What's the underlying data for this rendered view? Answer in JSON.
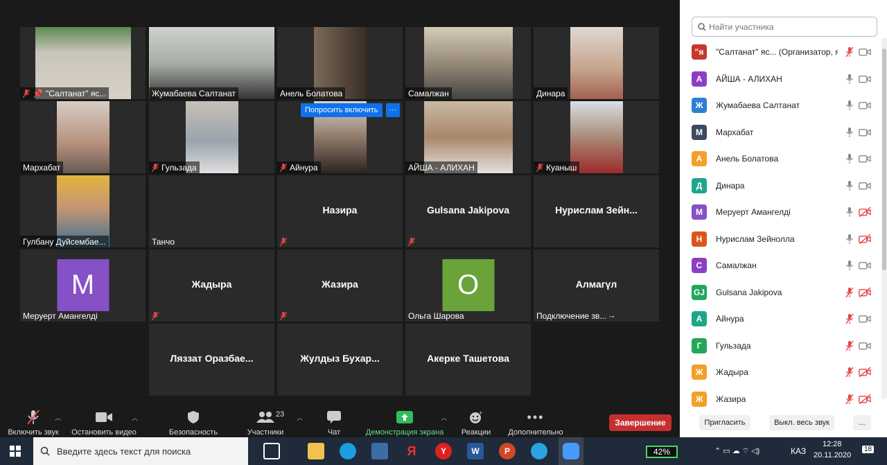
{
  "tiles_top": [
    {
      "name": "\"Салтанат\" яс...",
      "muted": true,
      "pinned": true
    },
    {
      "name": "Жумабаева Салтанат",
      "muted": false
    },
    {
      "name": "Анель Болатова",
      "muted": false
    },
    {
      "name": "Самалжан",
      "muted": false
    },
    {
      "name": "Динара",
      "muted": false
    }
  ],
  "tiles_row2": [
    {
      "name": "Мархабат",
      "muted": false
    },
    {
      "name": "Гульзада",
      "muted": true
    },
    {
      "name": "Айнура",
      "muted": true
    },
    {
      "name": "АЙША - АЛИХАН",
      "muted": false
    },
    {
      "name": "Куаныш",
      "muted": true
    }
  ],
  "tiles_row3": [
    {
      "name": "Гулбану Дуйсембае...",
      "muted": false
    },
    {
      "name": "Танчо",
      "muted": false
    },
    {
      "center": "Назира",
      "muted": true
    },
    {
      "center": "Gulsana Jakipova",
      "muted": true
    },
    {
      "center": "Нурислам  Зейн..."
    }
  ],
  "tiles_row4": [
    {
      "name": "Меруерт Амангелді",
      "avatar": "М",
      "color": "#8650c6"
    },
    {
      "center": "Жадыра",
      "muted": true
    },
    {
      "center": "Жазира",
      "muted": true
    },
    {
      "name": "Ольга Шарова",
      "avatar": "О",
      "color": "#6aa33a"
    },
    {
      "center": "Алмагүл",
      "name": "Подключение зв...  ·-"
    }
  ],
  "tiles_row5": [
    {
      "center": "Ляззат  Оразбае..."
    },
    {
      "center": "Жулдыз  Бухар..."
    },
    {
      "center": "Акерке Ташетова"
    }
  ],
  "ask_button": "Попросить включить",
  "more_button": "···",
  "toolbar": {
    "unmute": "Включить звук",
    "stop_video": "Остановить видео",
    "security": "Безопасность",
    "participants": "Участники",
    "participants_count": "23",
    "chat": "Чат",
    "share": "Демонстрация экрана",
    "reactions": "Реакции",
    "more": "Дополнительно",
    "end": "Завершение"
  },
  "panel": {
    "search_placeholder": "Найти участника",
    "invite": "Пригласить",
    "mute_all": "Выкл. весь звук",
    "more": "...",
    "participants": [
      {
        "initial": "\"я",
        "name": "\"Салтанат\" яс...  (Организатор, я)",
        "color": "#c8372d",
        "mic": "muted",
        "cam": "video"
      },
      {
        "initial": "А",
        "name": "АЙША - АЛИХАН",
        "color": "#8c3fc4",
        "mic": "on",
        "cam": "video"
      },
      {
        "initial": "Ж",
        "name": "Жумабаева Салтанат",
        "color": "#2d7fd6",
        "mic": "on",
        "cam": "video"
      },
      {
        "initial": "М",
        "name": "Мархабат",
        "color": "#3d4a5c",
        "mic": "on",
        "cam": "video"
      },
      {
        "initial": "А",
        "name": "Анель Болатова",
        "color": "#f3a028",
        "mic": "on",
        "cam": "video"
      },
      {
        "initial": "Д",
        "name": "Динара",
        "color": "#1ea58c",
        "mic": "on",
        "cam": "video"
      },
      {
        "initial": "М",
        "name": "Меруерт Амангелді",
        "color": "#8650c6",
        "mic": "on",
        "cam": "off"
      },
      {
        "initial": "Н",
        "name": "Нурислам Зейнолла",
        "color": "#d9561a",
        "mic": "on",
        "cam": "off"
      },
      {
        "initial": "С",
        "name": "Самалжан",
        "color": "#8c3fc4",
        "mic": "on",
        "cam": "video"
      },
      {
        "initial": "GJ",
        "name": "Gulsana Jakipova",
        "color": "#22a75b",
        "mic": "muted",
        "cam": "off"
      },
      {
        "initial": "А",
        "name": "Айнура",
        "color": "#1ea58c",
        "mic": "muted",
        "cam": "video"
      },
      {
        "initial": "Г",
        "name": "Гульзада",
        "color": "#22a75b",
        "mic": "muted",
        "cam": "video"
      },
      {
        "initial": "Ж",
        "name": "Жадыра",
        "color": "#f3a028",
        "mic": "muted",
        "cam": "off"
      },
      {
        "initial": "Ж",
        "name": "Жазира",
        "color": "#f3a028",
        "mic": "muted",
        "cam": "off"
      }
    ]
  },
  "taskbar": {
    "search_placeholder": "Введите здесь текст для поиска",
    "battery": "42%",
    "lang": "КАЗ",
    "time": "12:28",
    "date": "20.11.2020",
    "notifications": "18"
  }
}
